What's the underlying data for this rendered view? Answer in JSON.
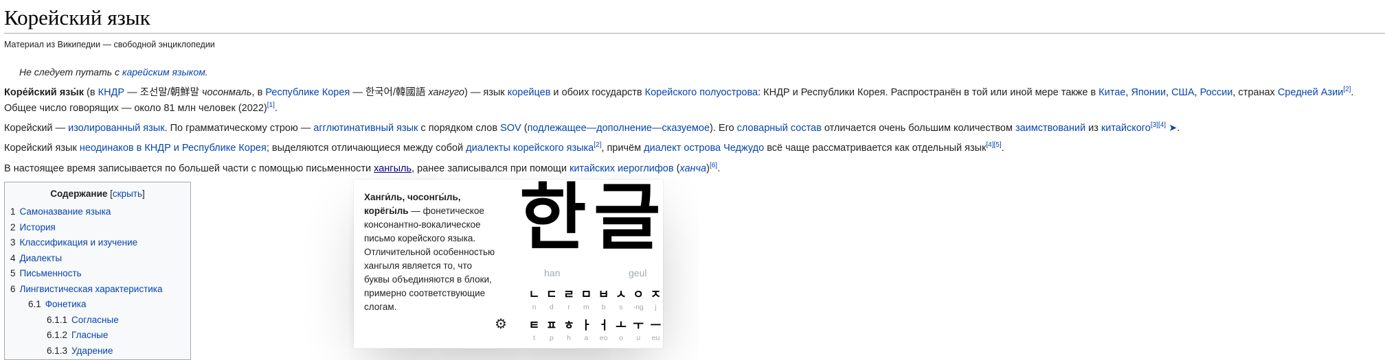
{
  "page": {
    "title": "Корейский язык",
    "tagline": "Материал из Википедии — свободной энциклопедии"
  },
  "hatnote": {
    "prefix": "Не следует путать с ",
    "link": "карейским языком",
    "suffix": "."
  },
  "p1": {
    "bold": "Коре́йский язы́к",
    "t1": " (в ",
    "l_kndr": "КНДР",
    "t2": " — 조선말/朝鮮말 ",
    "i1": "чосонмаль",
    "t3": ", в ",
    "l_rk": "Республике Корея",
    "t4": " — 한국어/韓國語 ",
    "i2": "хангуго",
    "t5": ") — язык ",
    "l_koreans": "корейцев",
    "t6": " и обоих государств ",
    "l_pen": "Корейского полуострова",
    "t7": ": КНДР и Республики Корея. Распространён в той или иной мере также в ",
    "l_china": "Китае",
    "c1": ", ",
    "l_japan": "Японии",
    "c2": ", ",
    "l_usa": "США",
    "c3": ", ",
    "l_russia": "России",
    "t8": ", странах ",
    "l_ca": "Средней Азии",
    "sup2": "[2]",
    "t9": ". Общее число говорящих — около 81 млн человек (2022)",
    "sup1": "[1]",
    "t10": "."
  },
  "p2": {
    "t1": "Корейский — ",
    "l_iso": "изолированный язык",
    "t2": ". По грамматическому строю — ",
    "l_agg": "агглютинативный язык",
    "t3": " с порядком слов ",
    "l_sov": "SOV",
    "t4": " (",
    "l_subj": "подлежащее",
    "d1": "—",
    "l_obj": "дополнение",
    "d2": "—",
    "l_pred": "сказуемое",
    "t5": "). Его ",
    "l_vocab": "словарный состав",
    "t6": " отличается очень большим количеством ",
    "l_loan": "заимствований",
    "t7": " из ",
    "l_chinese": "китайского",
    "sup34": "[3][4]",
    "play": " ➤",
    "t8": "."
  },
  "p3": {
    "t1": "Корейский язык ",
    "l_diff": "неодинаков в КНДР и Республике Корея",
    "t2": "; выделяются отличающиеся между собой ",
    "l_dial": "диалекты корейского языка",
    "sup2": "[2]",
    "t3": ", причём ",
    "l_jeju": "диалект острова Чеджудо",
    "t4": " всё чаще рассматривается как отдельный язык",
    "sup45": "[4][5]",
    "t5": "."
  },
  "p4": {
    "t1": "В настоящее время записывается по большей части с помощью письменности ",
    "l_hangul": "хангыль",
    "t2": ", ранее записывался при помощи ",
    "l_hanja": "китайских иероглифов",
    "t3": " (",
    "i_hancha": "ханча",
    "t4": ")",
    "sup6": "[6]",
    "t5": "."
  },
  "toc": {
    "title": "Содержание",
    "toggle": "скрыть",
    "items": [
      {
        "num": "1",
        "label": "Самоназвание языка"
      },
      {
        "num": "2",
        "label": "История"
      },
      {
        "num": "3",
        "label": "Классификация и изучение"
      },
      {
        "num": "4",
        "label": "Диалекты"
      },
      {
        "num": "5",
        "label": "Письменность"
      },
      {
        "num": "6",
        "label": "Лингвистическая характеристика"
      },
      {
        "num": "6.1",
        "label": "Фонетика"
      },
      {
        "num": "6.1.1",
        "label": "Согласные"
      },
      {
        "num": "6.1.2",
        "label": "Гласные"
      },
      {
        "num": "6.1.3",
        "label": "Ударение"
      }
    ]
  },
  "popup": {
    "bold": "Ханги́ль, чосонгы́ль, корёгы́ль",
    "text": " — фонетическое консонантно-вокалическое письмо корейского языка. Отличительной особенностью хангыля является то, что буквы объединяются в блоки, примерно соответствующие слогам.",
    "settings_icon": "gear-icon",
    "image": {
      "syllable1": "한",
      "syllable2": "글",
      "label1": "han",
      "label2": "geul",
      "row1_jamo": [
        "ㄴ",
        "ㄷ",
        "ㄹ",
        "ㅁ",
        "ㅂ",
        "ㅅ",
        "ㅇ",
        "ㅈ"
      ],
      "row1_rom": [
        "n",
        "d",
        "r",
        "m",
        "b",
        "s",
        "-ng",
        "j"
      ],
      "row2_jamo": [
        "ㅌ",
        "ㅍ",
        "ㅎ",
        "ㅏ",
        "ㅓ",
        "ㅗ",
        "ㅜ",
        "ㅡ"
      ],
      "row2_rom": [
        "t",
        "p",
        "h",
        "a",
        "eo",
        "o",
        "u",
        "eu"
      ]
    }
  }
}
